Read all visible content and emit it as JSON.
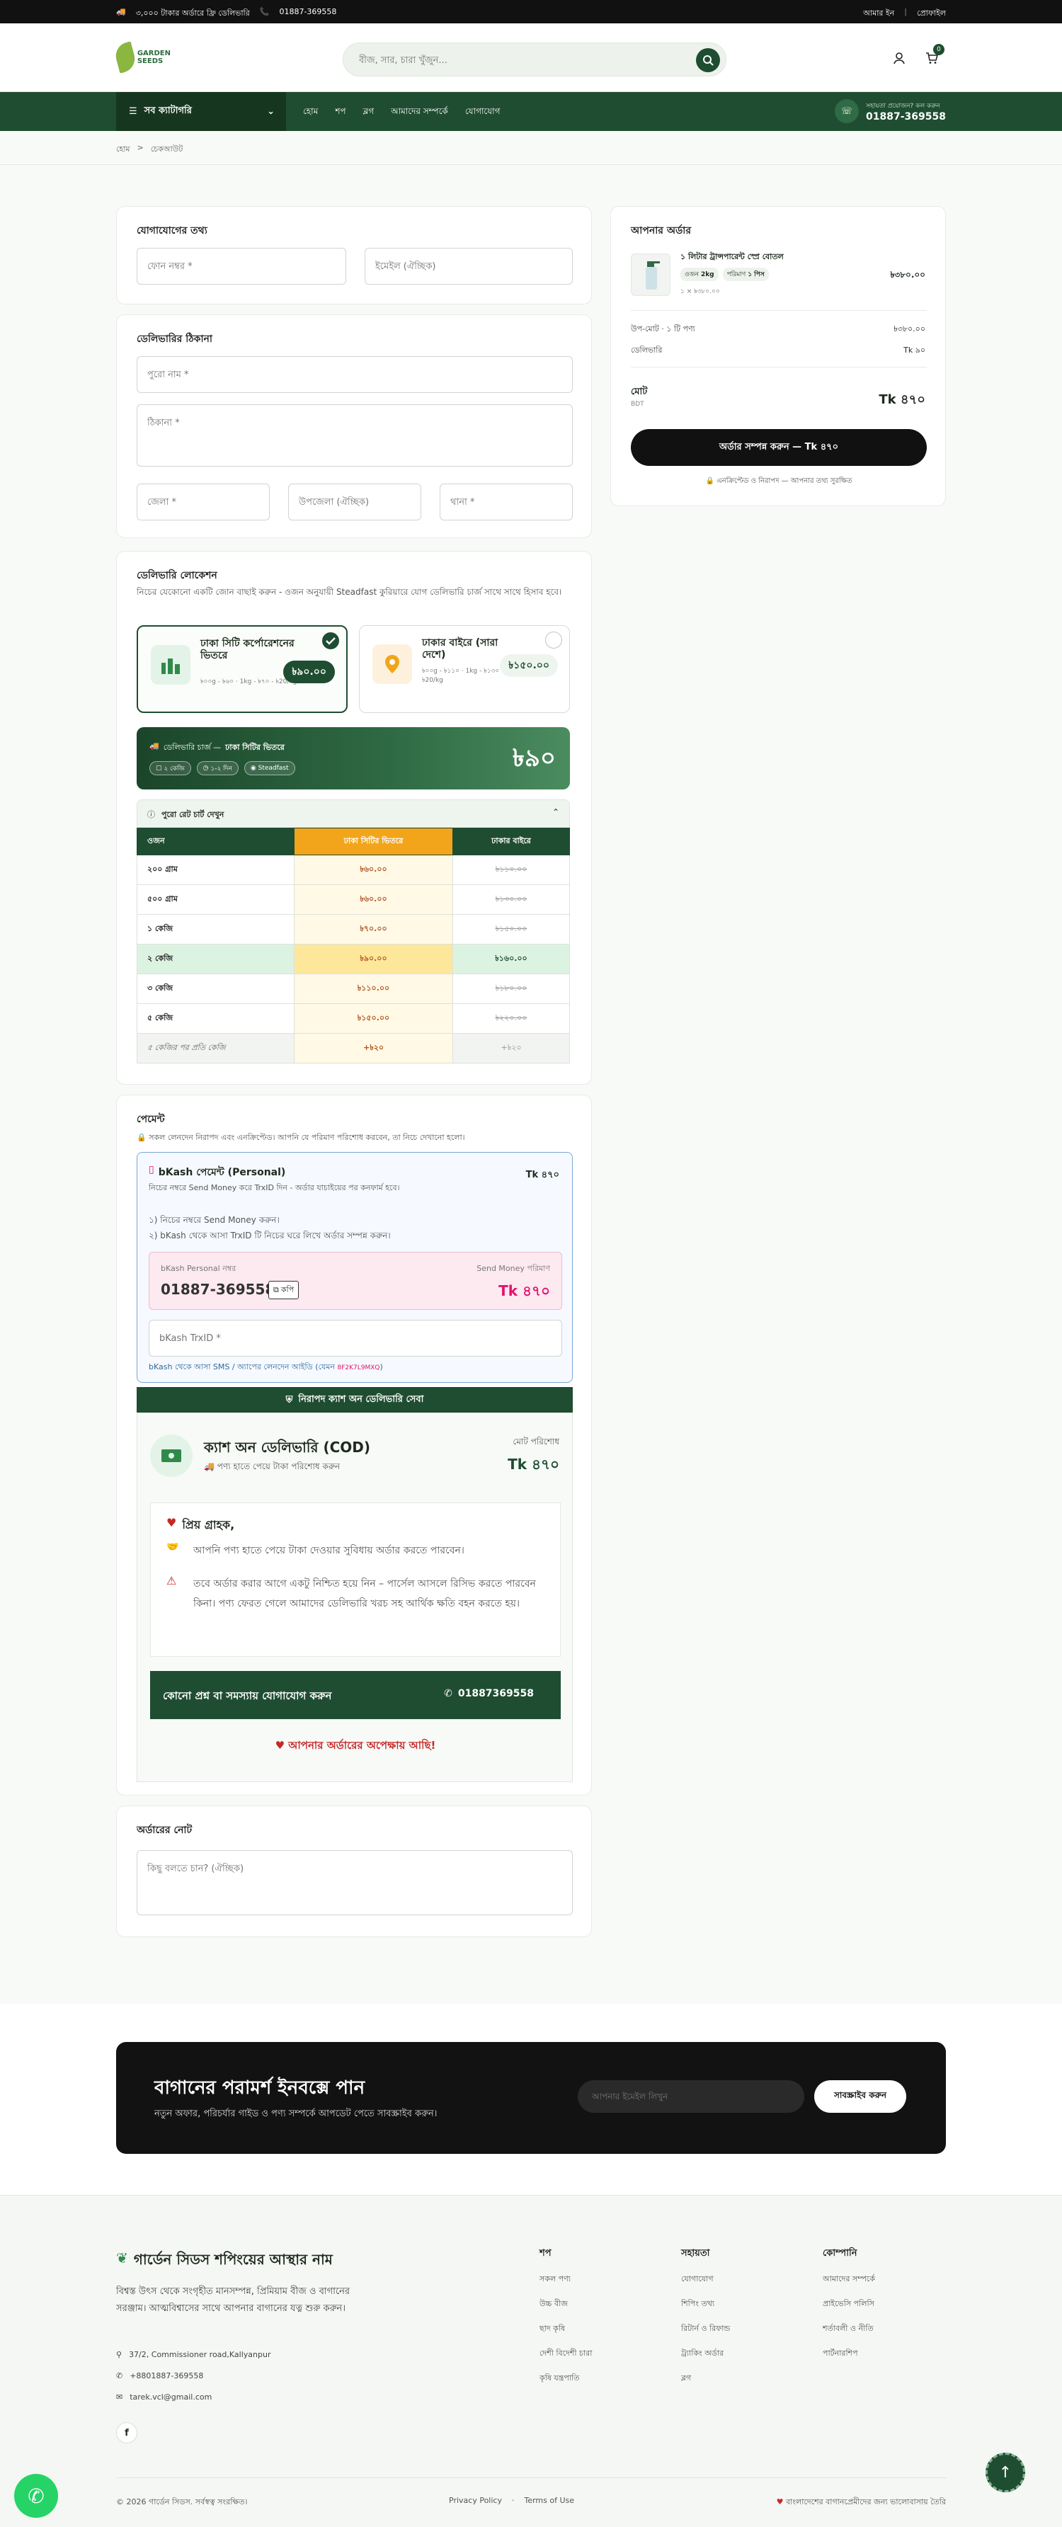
{
  "topbar": {
    "free_delivery": "৩,০০০ টাকার অর্ডারে ফ্রি ডেলিভারি",
    "phone": "01887-369558",
    "account": "আমার ইন",
    "wishlist": "প্রোফাইল"
  },
  "header": {
    "search_placeholder": "বীজ, সার, চারা খুঁজুন...",
    "cart_count": "0",
    "logo_text": "GARDEN SEEDS"
  },
  "nav": {
    "all_categories": "সব ক্যাটাগরি",
    "links": [
      "হোম",
      "শপ",
      "ব্লগ",
      "আমাদের সম্পর্কে",
      "যোগাযোগ"
    ],
    "hotline_label": "সহায়তা প্রয়োজন? কল করুন",
    "hotline": "01887-369558"
  },
  "breadcrumb": {
    "home": "হোম",
    "sep": ">",
    "current": "চেকআউট"
  },
  "contact": {
    "title": "যোগাযোগের তথ্য",
    "phone_placeholder": "ফোন নম্বর *",
    "email_placeholder": "ইমেইল (ঐচ্ছিক)"
  },
  "address": {
    "title": "ডেলিভারির ঠিকানা",
    "name_placeholder": "পুরো নাম *",
    "address_placeholder": "ঠিকানা *",
    "district_placeholder": "জেলা *",
    "upazila_placeholder": "উপজেলা (ঐচ্ছিক)",
    "thana_placeholder": "থানা *"
  },
  "delivery": {
    "title": "ডেলিভারি লোকেশন",
    "desc": "নিচের যেকোনো একটি জোন বাছাই করুন - ওজন অনুযায়ী Steadfast কুরিয়ারে যোগ ডেলিভারি চার্জ সাথে সাথে হিসাব হবে।",
    "zone_inside": {
      "name": "ঢাকা সিটি কর্পোরেশনের ভিতরে",
      "rates": "৳০০g - ৳৬০ · 1kg - ৳৭০ - ৳20/kg",
      "price": "৳৯০.০০"
    },
    "zone_outside": {
      "name": "ঢাকার বাইরে (সারা দেশে)",
      "rates": "৳০০g - ৳১১০ · 1kg - ৳১৩০ - ৳20/kg",
      "price": "৳১৫০.০০"
    },
    "banner_label": "ডেলিভারি চার্জ —",
    "banner_zone": "ঢাকা সিটির ভিতরে",
    "pill_weight": "২ কেজি",
    "pill_days": "১-২ দিন",
    "pill_courier": "Steadfast",
    "banner_amount": "৳৯০",
    "rate_toggle": "পুরো রেট চার্ট দেখুন",
    "table_headers": [
      "ওজন",
      "ঢাকা সিটির ভিতরে",
      "ঢাকার বাইরে"
    ],
    "rows": [
      [
        "২০০ গ্রাম",
        "৳৬০.০০",
        "৳১১০.০০"
      ],
      [
        "৫০০ গ্রাম",
        "৳৬০.০০",
        "৳১৩০.০০"
      ],
      [
        "১ কেজি",
        "৳৭০.০০",
        "৳১৫০.০০"
      ],
      [
        "২ কেজি",
        "৳৯০.০০",
        "৳১৬০.০০"
      ],
      [
        "৩ কেজি",
        "৳১১০.০০",
        "৳১৮০.০০"
      ],
      [
        "৫ কেজি",
        "৳১৫০.০০",
        "৳২২০.০০"
      ],
      [
        "৫ কেজির পর প্রতি কেজি",
        "+৳২০",
        "+৳২০"
      ]
    ]
  },
  "payment": {
    "title": "পেমেন্ট",
    "secure_note": "সকল লেনদেন নিরাপদ এবং এনক্রিপ্টেড। আপনি যে পরিমাণ পরিশোধ করবেন, তা নিচে দেখানো হলো।",
    "bkash_title": "bKash পেমেন্ট (Personal)",
    "bkash_amount": "Tk ৪৭০",
    "bkash_sub": "নিচের নম্বরে Send Money করে TrxID দিন - অর্ডার যাচাইয়ের পর কনফার্ম হবে।",
    "step1": "১) নিচের নম্বরে Send Money করুন।",
    "step2": "২) bKash থেকে আসা TrxID টি নিচের ঘরে লিখে অর্ডার সম্পন্ন করুন।",
    "bkash_number_label": "bKash Personal নম্বর",
    "bkash_number": "01887-369558",
    "copy_label": "কপি",
    "send_label": "Send Money পরিমাণ",
    "send_amount": "Tk ৪৭০",
    "trx_placeholder": "bKash TrxID *",
    "trx_help": "bKash থেকে আসা SMS / অ্যাপের লেনদেন আইডি (যেমন",
    "trx_example": "8F2K7L9MXQ",
    "cod_ribbon": "নিরাপদ ক্যাশ অন ডেলিভারি সেবা",
    "cod_title": "ক্যাশ অন ডেলিভারি (COD)",
    "cod_sub": "পণ্য হাতে পেয়ে টাকা পরিশোধ করুন",
    "cod_total_label": "মোট পরিশোধ",
    "cod_total": "Tk ৪৭০",
    "dear": "প্রিয় গ্রাহক,",
    "note1": "আপনি পণ্য হাতে পেয়ে টাকা দেওয়ার সুবিধায় অর্ডার করতে পারবেন।",
    "note2": "তবে অর্ডার করার আগে একটু নিশ্চিত হয়ে নিন – পার্সেল আসলে রিসিভ করতে পারবেন কিনা। পণ্য ফেরত গেলে আমাদের ডেলিভারি খরচ সহ আর্থিক ক্ষতি বহন করতে হয়।",
    "help_label": "কোনো প্রশ্ন বা সমস্যায় যোগাযোগ করুন",
    "help_phone": "01887369558",
    "waiting": "আপনার অর্ডারের অপেক্ষায় আছি!"
  },
  "order_note": {
    "title": "অর্ডারের নোট",
    "placeholder": "কিছু বলতে চান? (ঐচ্ছিক)"
  },
  "summary": {
    "title": "আপনার অর্ডার",
    "item_name": "১ লিটার ট্রান্সপারেন্ট স্প্রে বোতল",
    "tag_weight_label": "ওজন",
    "tag_weight": "2kg",
    "tag_qty_label": "পরিমাণ",
    "tag_qty": "১ পিস",
    "item_unit": "১ × ৳৩৮০.০০",
    "item_price": "৳৩৮০.০০",
    "subtotal_label": "উপ-মোট · ১ টি পণ্য",
    "subtotal": "৳৩৮০.০০",
    "delivery_label": "ডেলিভারি",
    "delivery": "Tk ৯০",
    "total_label": "মোট",
    "currency": "BDT",
    "total": "Tk ৪৭০",
    "cta": "অর্ডার সম্পন্ন করুন — Tk ৪৭০",
    "secure": "এনক্রিপ্টেড ও নিরাপদ — আপনার তথ্য সুরক্ষিত"
  },
  "newsletter": {
    "title": "বাগানের পরামর্শ ইনবক্সে পান",
    "sub": "নতুন অফার, পরিচর্যার গাইড ও পণ্য সম্পর্কে আপডেট পেতে সাবস্ক্রাইব করুন।",
    "placeholder": "আপনার ইমেইল লিখুন",
    "button": "সাবস্ক্রাইব করুন"
  },
  "footer": {
    "brand": "গার্ডেন সিডস শপিংয়ের আস্থার নাম",
    "about": "বিশ্বস্ত উৎস থেকে সংগৃহীত মানসম্পন্ন, প্রিমিয়াম বীজ ও বাগানের সরঞ্জাম। আত্মবিশ্বাসের সাথে আপনার বাগানের যত্ন শুরু করুন।",
    "address": "37/2, Commissioner road,Kallyanpur",
    "phone": "+8801887-369558",
    "email": "tarek.vcl@gmail.com",
    "col1_title": "শপ",
    "col1": [
      "সকল পণ্য",
      "উচ্চ বীজ",
      "ছাদ কৃষি",
      "দেশী বিদেশী চারা",
      "কৃষি যন্ত্রপাতি"
    ],
    "col2_title": "সহায়তা",
    "col2": [
      "যোগাযোগ",
      "শিপিং তথ্য",
      "রিটার্ন ও রিফান্ড",
      "ট্র্যাকিং অর্ডার",
      "ব্লগ"
    ],
    "col3_title": "কোম্পানি",
    "col3": [
      "আমাদের সম্পর্কে",
      "প্রাইভেসি পলিসি",
      "শর্তাবলী ও নীতি",
      "পার্টনারশিপ"
    ],
    "copyright": "© 2026 গার্ডেন সিডস. সর্বস্বত্ব সংরক্ষিত।",
    "privacy": "Privacy Policy",
    "terms": "Terms of Use",
    "made": "বাংলাদেশের বাগানপ্রেমীদের জন্য ভালোবাসায় তৈরি"
  },
  "colors": {
    "primary": "#1f4d31",
    "accent": "#f2a51a",
    "bkash": "#e2136e",
    "danger": "#c62828"
  }
}
